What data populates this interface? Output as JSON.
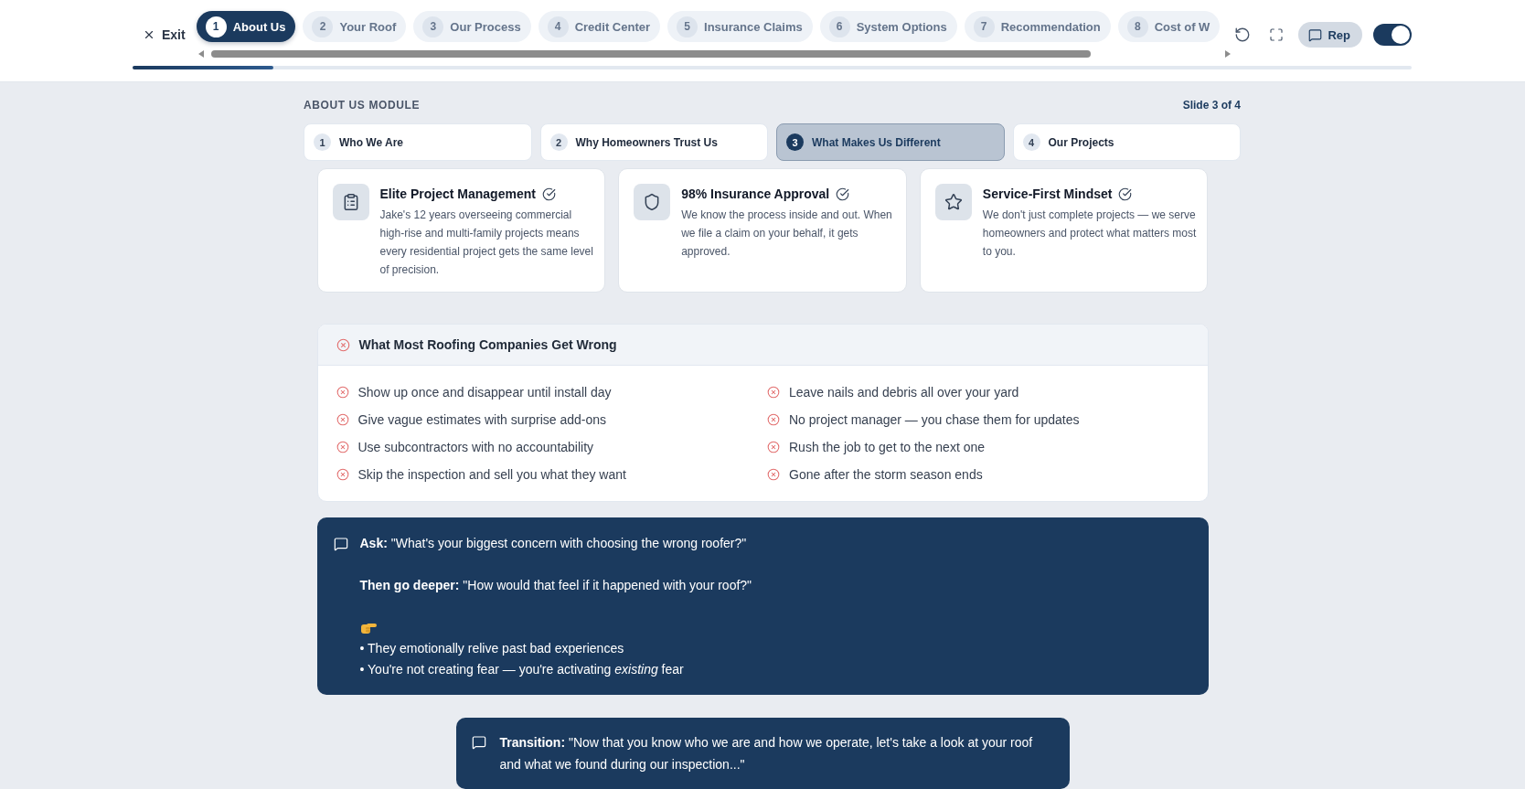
{
  "header": {
    "exit": "Exit",
    "tabs": [
      {
        "number": "1",
        "label": "About Us",
        "selected": true
      },
      {
        "number": "2",
        "label": "Your Roof",
        "selected": false
      },
      {
        "number": "3",
        "label": "Our Process",
        "selected": false
      },
      {
        "number": "4",
        "label": "Credit Center",
        "selected": false
      },
      {
        "number": "5",
        "label": "Insurance Claims",
        "selected": false
      },
      {
        "number": "6",
        "label": "System Options",
        "selected": false
      },
      {
        "number": "7",
        "label": "Recommendation",
        "selected": false
      },
      {
        "number": "8",
        "label": "Cost of W",
        "selected": false
      }
    ],
    "progress": {
      "level": 0.11
    },
    "rep_button": "Rep",
    "toggle": {
      "on": true
    }
  },
  "module": {
    "title": "ABOUT US MODULE",
    "counter": "Slide 3 of 4",
    "slides": [
      {
        "number": "1",
        "label": "Who We Are",
        "selected": false
      },
      {
        "number": "2",
        "label": "Why Homeowners Trust Us",
        "selected": false
      },
      {
        "number": "3",
        "label": "What Makes Us Different",
        "selected": true
      },
      {
        "number": "4",
        "label": "Our Projects",
        "selected": false
      }
    ]
  },
  "features": [
    {
      "kind": "clipboard",
      "title": "Elite Project Management",
      "text": "Jake's 12 years overseeing commercial high-rise and multi-family projects means every residential project gets the same level of precision."
    },
    {
      "kind": "shield",
      "title": "98% Insurance Approval",
      "text": "We know the process inside and out. When we file a claim on your behalf, it gets approved."
    },
    {
      "kind": "star",
      "title": "Service-First Mindset",
      "text": "We don't just complete projects — we serve homeowners and protect what matters most to you."
    }
  ],
  "mistakes": {
    "title": "What Most Roofing Companies Get Wrong",
    "items": [
      "Show up once and disappear until install day",
      "Leave nails and debris all over your yard",
      "Give vague estimates with surprise add-ons",
      "No project manager — you chase them for updates",
      "Use subcontractors with no accountability",
      "Rush the job to get to the next one",
      "Skip the inspection and sell you what they want",
      "Gone after the storm season ends"
    ]
  },
  "coaching": {
    "prompts": [
      "**Ask:** \"What's your biggest concern with choosing the wrong roofer?\"",
      "**Then go deeper:** \"How would that feel if it happened with your roof?\""
    ],
    "bullets": [
      "• They emotionally relive past bad experiences",
      "• You're not creating fear — you're activating *existing* fear"
    ]
  },
  "transition": "**Transition:** \"Now that you know who we are and how we operate, let's take a look at your roof and what we found during our inspection...\""
}
